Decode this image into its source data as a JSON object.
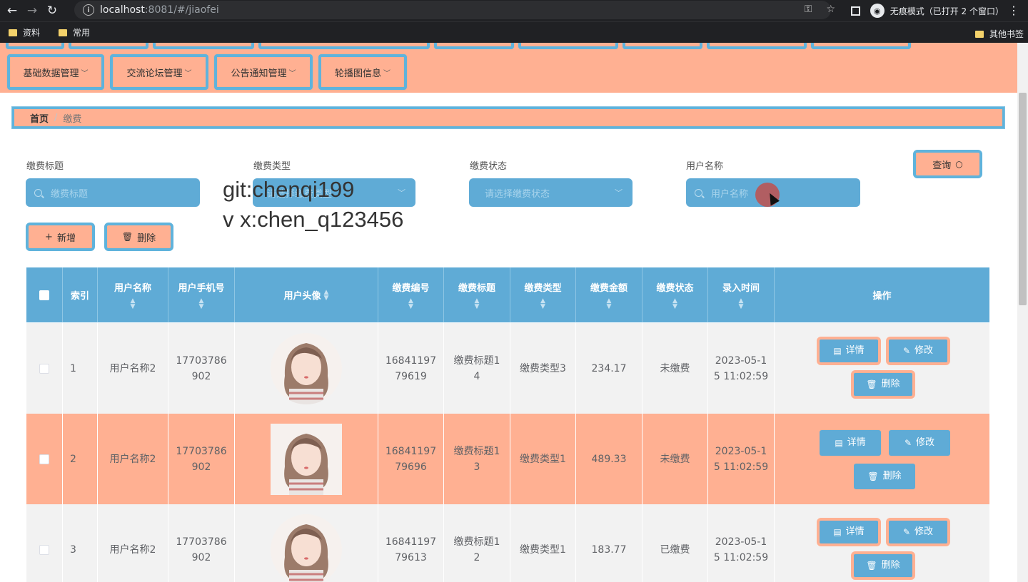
{
  "browser": {
    "url_host": "localhost",
    "url_rest": ":8081/#/jiaofei",
    "incognito_text": "无痕模式（已打开 2 个窗口）",
    "bookmarks": [
      "资料",
      "常用"
    ],
    "other_bookmarks": "其他书签"
  },
  "menu": {
    "items": [
      "基础数据管理",
      "交流论坛管理",
      "公告通知管理",
      "轮播图信息"
    ]
  },
  "breadcrumb": {
    "home": "首页",
    "current": "缴费"
  },
  "filters": {
    "title_label": "缴费标题",
    "title_placeholder": "缴费标题",
    "type_label": "缴费类型",
    "type_placeholder": "请选择缴费类型",
    "status_label": "缴费状态",
    "status_placeholder": "请选择缴费状态",
    "user_label": "用户名称",
    "user_placeholder": "用户名称",
    "query_label": "查询"
  },
  "actions": {
    "add_label": "新增",
    "delete_label": "删除"
  },
  "watermark": {
    "line1": "git:chenqi199",
    "line2": "v x:chen_q123456"
  },
  "table": {
    "columns": {
      "index": "索引",
      "user_name": "用户名称",
      "user_phone": "用户手机号",
      "avatar": "用户头像",
      "pay_no": "缴费编号",
      "pay_title": "缴费标题",
      "pay_type": "缴费类型",
      "pay_amount": "缴费金额",
      "pay_status": "缴费状态",
      "created_time": "录入时间",
      "operation": "操作"
    },
    "row_actions": {
      "detail": "详情",
      "edit": "修改",
      "delete": "删除"
    },
    "rows": [
      {
        "index": "1",
        "user_name": "用户名称2",
        "phone_a": "17703786",
        "phone_b": "902",
        "no_a": "16841197",
        "no_b": "79619",
        "title_a": "缴费标题1",
        "title_b": "4",
        "type": "缴费类型3",
        "amount": "234.17",
        "status": "未缴费",
        "time_a": "2023-05-1",
        "time_b": "5 11:02:59"
      },
      {
        "index": "2",
        "user_name": "用户名称2",
        "phone_a": "17703786",
        "phone_b": "902",
        "no_a": "16841197",
        "no_b": "79696",
        "title_a": "缴费标题1",
        "title_b": "3",
        "type": "缴费类型1",
        "amount": "489.33",
        "status": "未缴费",
        "time_a": "2023-05-1",
        "time_b": "5 11:02:59"
      },
      {
        "index": "3",
        "user_name": "用户名称2",
        "phone_a": "17703786",
        "phone_b": "902",
        "no_a": "16841197",
        "no_b": "79613",
        "title_a": "缴费标题1",
        "title_b": "2",
        "type": "缴费类型1",
        "amount": "183.77",
        "status": "已缴费",
        "time_a": "2023-05-1",
        "time_b": "5 11:02:59"
      }
    ]
  },
  "colors": {
    "accent_orange": "#ffb092",
    "accent_blue": "#5fabd6"
  }
}
